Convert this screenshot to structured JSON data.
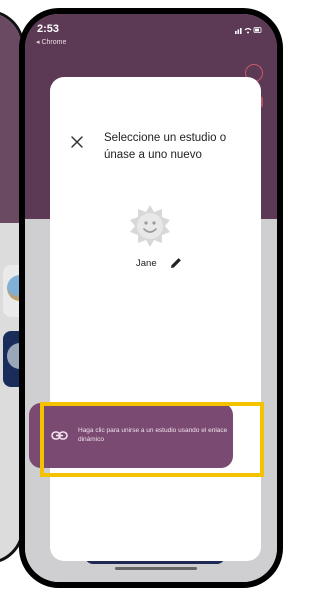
{
  "status_bar": {
    "time": "2:53",
    "back_app": "◂ Chrome"
  },
  "modal": {
    "title": "Seleccione un estudio o únase a uno nuevo",
    "user_name": "Jane",
    "join_link_text": "Haga clic para unirse a un estudio usando el enlace dinámico"
  },
  "colors": {
    "accent_purple": "#7a4a72",
    "header_purple": "#5c3954",
    "highlight": "#f5c200"
  },
  "icons": {
    "close": "close-icon",
    "avatar": "avatar-icon",
    "edit": "pencil-icon",
    "link": "link-icon"
  }
}
